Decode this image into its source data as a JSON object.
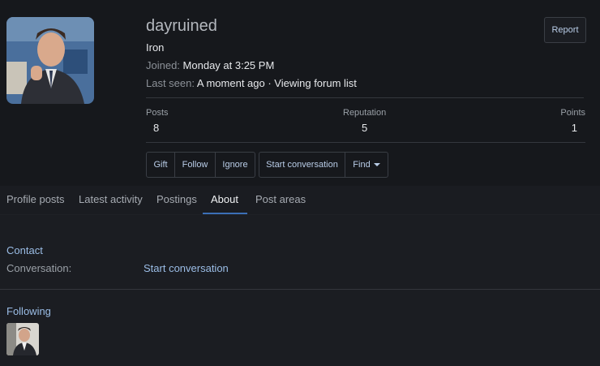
{
  "profile": {
    "username": "dayruined",
    "rank": "Iron",
    "joined_label": "Joined:",
    "joined_value": "Monday at 3:25 PM",
    "last_seen_label": "Last seen:",
    "last_seen_value": "A moment ago · Viewing forum list",
    "report_label": "Report",
    "avatar_icon": "user-avatar-photo"
  },
  "stats": {
    "posts_label": "Posts",
    "posts_value": "8",
    "reputation_label": "Reputation",
    "reputation_value": "5",
    "points_label": "Points",
    "points_value": "1"
  },
  "actions": {
    "gift": "Gift",
    "follow": "Follow",
    "ignore": "Ignore",
    "start_conversation": "Start conversation",
    "find": "Find"
  },
  "tabs": [
    "Profile posts",
    "Latest activity",
    "Postings",
    "About",
    "Post areas"
  ],
  "active_tab": "About",
  "about": {
    "contact_title": "Contact",
    "conversation_label": "Conversation:",
    "conversation_link": "Start conversation",
    "following_title": "Following"
  },
  "colors": {
    "accent": "#3b6fb6",
    "link": "#9bbde6",
    "background": "#1b1d22"
  }
}
